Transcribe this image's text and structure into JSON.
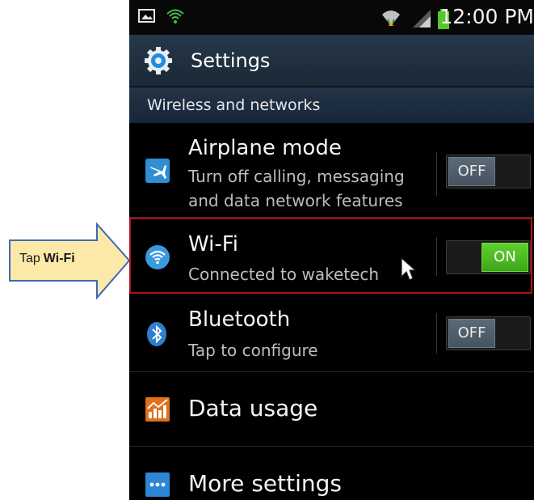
{
  "callout": {
    "prefix": "Tap",
    "target": "Wi-Fi",
    "fill_color": "#fde9a7",
    "border_color": "#3c6ab7"
  },
  "status_bar": {
    "time": "12:00 PM",
    "icons": [
      "screenshot-icon",
      "wifi-notification-icon",
      "wifi-signal-icon",
      "cell-signal-icon",
      "battery-icon"
    ]
  },
  "action_bar": {
    "title": "Settings",
    "icon": "gear-icon"
  },
  "section": {
    "header": "Wireless and networks"
  },
  "items": [
    {
      "id": "airplane",
      "icon": "airplane-icon",
      "title": "Airplane mode",
      "subtitle": "Turn off calling, messaging and data network features",
      "subtitle_line1": "Turn off calling, messaging",
      "subtitle_line2": "and data network features",
      "toggle": "OFF"
    },
    {
      "id": "wifi",
      "icon": "wifi-icon",
      "title": "Wi-Fi",
      "subtitle": "Connected to waketech",
      "toggle": "ON"
    },
    {
      "id": "bluetooth",
      "icon": "bluetooth-icon",
      "title": "Bluetooth",
      "subtitle": "Tap to configure",
      "toggle": "OFF"
    },
    {
      "id": "data-usage",
      "icon": "data-usage-icon",
      "title": "Data usage"
    },
    {
      "id": "more-settings",
      "icon": "more-icon",
      "title": "More settings"
    }
  ],
  "colors": {
    "toggle_on": "#4cbf22",
    "toggle_off": "#52606c",
    "highlight": "#b0101a",
    "action_bar": "#1f2f3f"
  }
}
